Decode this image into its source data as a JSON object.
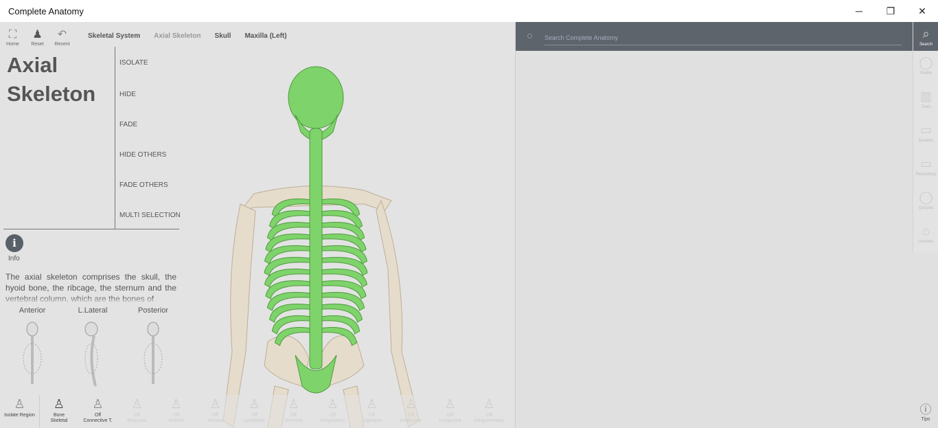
{
  "window": {
    "title": "Complete Anatomy",
    "minimize": "─",
    "restore": "❐",
    "close": "✕"
  },
  "nav": {
    "home": "Home",
    "reset": "Reset",
    "recent": "Recent"
  },
  "breadcrumb": [
    "Skeletal System",
    "Axial Skeleton",
    "Skull",
    "Maxilla (Left)"
  ],
  "panel": {
    "title_line1": "Axial",
    "title_line2": "Skeleton",
    "actions": [
      "ISOLATE",
      "HIDE",
      "FADE",
      "HIDE OTHERS",
      "FADE OTHERS",
      "MULTI SELECTION"
    ],
    "info_label": "Info",
    "description": "The axial skeleton comprises the skull, the hyoid bone, the ribcage, the sternum and the vertebral column, which are the bones of",
    "views": [
      "Anterior",
      "L.Lateral",
      "Posterior"
    ]
  },
  "systems": [
    {
      "top": "",
      "label": "Isolate Region"
    },
    {
      "top": "Bone",
      "label": "Skeletal"
    },
    {
      "top": "Off",
      "label": "Connective T."
    },
    {
      "top": "Off",
      "label": "Muscular"
    },
    {
      "top": "Off",
      "label": "Arterial"
    },
    {
      "top": "Off",
      "label": "Venous"
    },
    {
      "top": "Off",
      "label": "Lymphatic"
    },
    {
      "top": "Off",
      "label": "Nervous"
    },
    {
      "top": "Off",
      "label": "Respiratory"
    },
    {
      "top": "Off",
      "label": "Digestive"
    },
    {
      "top": "Off",
      "label": "Endocrine"
    },
    {
      "top": "Off",
      "label": "Urogenital"
    },
    {
      "top": "Off",
      "label": "Integumentary"
    }
  ],
  "search": {
    "placeholder": "Search Complete Anatomy"
  },
  "rail": [
    "Search",
    "Profile",
    "Tools",
    "Screens",
    "Recordings",
    "Quizzes",
    "Lectures"
  ],
  "tips": "Tips",
  "colors": {
    "highlight": "#7ed36a",
    "bone": "#e6dccb",
    "dark_panel": "#5d646c"
  }
}
